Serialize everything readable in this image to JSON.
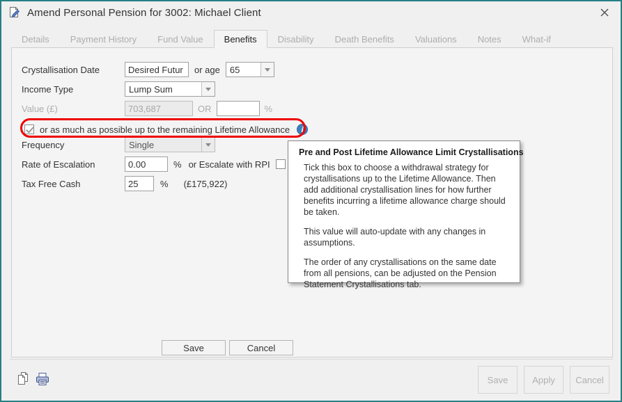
{
  "window": {
    "title": "Amend Personal Pension for 3002: Michael Client",
    "title_icon": "document-edit-icon",
    "close_label": "close-icon",
    "border_color": "#277f86"
  },
  "tabs": [
    {
      "label": "Details",
      "selected": false
    },
    {
      "label": "Payment History",
      "selected": false
    },
    {
      "label": "Fund Value",
      "selected": false
    },
    {
      "label": "Benefits",
      "selected": true
    },
    {
      "label": "Disability",
      "selected": false
    },
    {
      "label": "Death Benefits",
      "selected": false
    },
    {
      "label": "Valuations",
      "selected": false
    },
    {
      "label": "Notes",
      "selected": false
    },
    {
      "label": "What-if",
      "selected": false
    }
  ],
  "form": {
    "crystallisation_date": {
      "label": "Crystallisation Date",
      "value": "Desired Futur",
      "or_age_label": "or age",
      "age_value": "65"
    },
    "income_type": {
      "label": "Income Type",
      "value": "Lump Sum"
    },
    "value_gbp": {
      "label": "Value (£)",
      "value": "703,687",
      "or_label": "OR",
      "percent_value": "",
      "percent_symbol": "%"
    },
    "lta_checkbox": {
      "label": "or as much as possible up to the remaining Lifetime Allowance",
      "checked": true,
      "info_glyph": "i",
      "highlight_color": "#ee0000"
    },
    "frequency": {
      "label": "Frequency",
      "value": "Single"
    },
    "rate_of_escalation": {
      "label": "Rate of Escalation",
      "value": "0.00",
      "percent_symbol": "%",
      "rpi_label": "or Escalate with RPI",
      "rpi_checked": false
    },
    "tax_free_cash": {
      "label": "Tax Free Cash",
      "value": "25",
      "percent_symbol": "%",
      "amount": "(£175,922)"
    }
  },
  "tooltip": {
    "title": "Pre and Post Lifetime Allowance Limit Crystallisations",
    "paragraphs": [
      "Tick this box to choose a withdrawal strategy for crystallisations up to the Lifetime Allowance. Then add additional crystallisation lines for how further benefits incurring a lifetime allowance charge should be taken.",
      "This value will auto-update with any changes in assumptions.",
      "The order of any crystallisations on the same date from all pensions, can be adjusted on the Pension Statement Crystallisations tab."
    ]
  },
  "inner_buttons": {
    "save": "Save",
    "cancel": "Cancel"
  },
  "footer": {
    "copy_icon": "copy-icon",
    "print_icon": "print-icon",
    "save": "Save",
    "apply": "Apply",
    "cancel": "Cancel"
  }
}
